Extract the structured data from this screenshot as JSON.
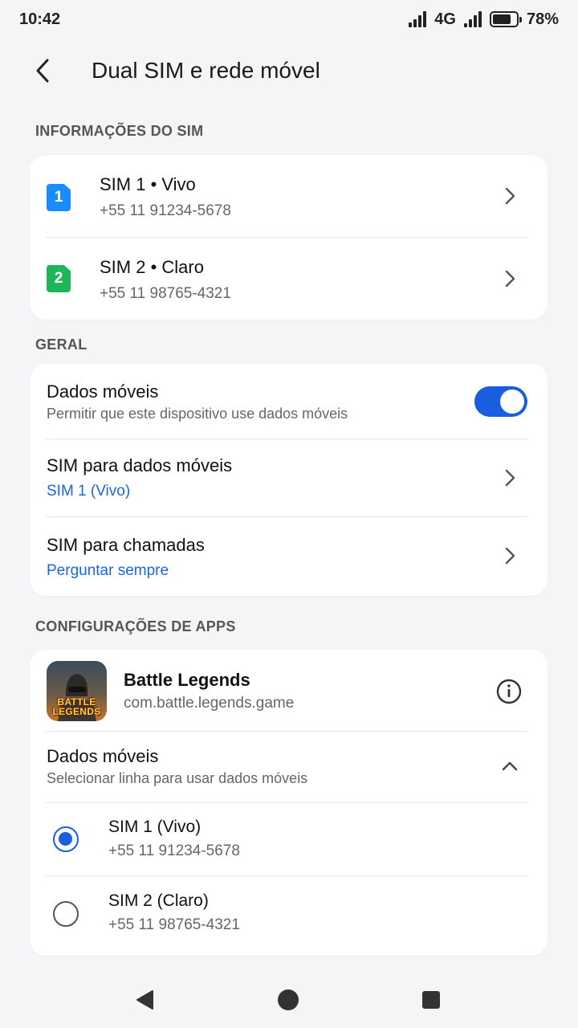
{
  "status_bar": {
    "time": "10:42",
    "network": "4G",
    "battery": "78%",
    "battery_level": 0.78
  },
  "header": {
    "title": "Dual SIM e rede móvel"
  },
  "sim_info": {
    "section_title": "INFORMAÇÕES DO SIM",
    "sims": [
      {
        "badge": "1",
        "title": "SIM 1 • Vivo",
        "number": "+55 11 91234-5678",
        "color": "#1a8cff"
      },
      {
        "badge": "2",
        "title": "SIM 2 • Claro",
        "number": "+55 11 98765-4321",
        "color": "#1fb55a"
      }
    ]
  },
  "general": {
    "section_title": "GERAL",
    "mobile_data": {
      "title": "Dados móveis",
      "subtitle": "Permitir que este dispositivo use dados móveis",
      "enabled": true
    },
    "data_sim": {
      "title": "SIM para dados móveis",
      "value": "SIM 1 (Vivo)"
    },
    "call_sim": {
      "title": "SIM para chamadas",
      "value": "Perguntar sempre"
    }
  },
  "app_settings": {
    "section_title": "CONFIGURAÇÕES DE APPS",
    "app": {
      "name": "Battle Legends",
      "package": "com.battle.legends.game",
      "icon_text": "BATTLE LEGENDS"
    },
    "mobile_data": {
      "title": "Dados móveis",
      "subtitle": "Selecionar linha para usar dados móveis"
    },
    "options": [
      {
        "title": "SIM 1 (Vivo)",
        "number": "+55 11 91234-5678",
        "selected": true
      },
      {
        "title": "SIM 2 (Claro)",
        "number": "+55 11 98765-4321",
        "selected": false
      }
    ]
  },
  "colors": {
    "accent": "#1a5ee0",
    "link": "#1a66e0",
    "background": "#f5f5f7"
  }
}
